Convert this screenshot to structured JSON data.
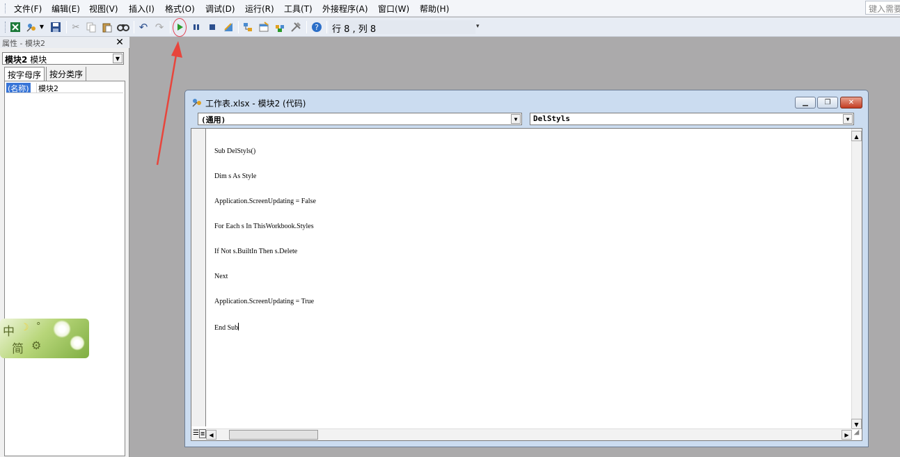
{
  "menubar": {
    "items": [
      {
        "label": "文件(F)"
      },
      {
        "label": "编辑(E)"
      },
      {
        "label": "视图(V)"
      },
      {
        "label": "插入(I)"
      },
      {
        "label": "格式(O)"
      },
      {
        "label": "调试(D)"
      },
      {
        "label": "运行(R)"
      },
      {
        "label": "工具(T)"
      },
      {
        "label": "外接程序(A)"
      },
      {
        "label": "窗口(W)"
      },
      {
        "label": "帮助(H)"
      }
    ],
    "search_placeholder": "键入需要"
  },
  "toolbar": {
    "icons": [
      "excel-icon",
      "insert-module-icon",
      "save-icon",
      "cut-icon",
      "copy-icon",
      "paste-icon",
      "find-icon",
      "undo-icon",
      "redo-icon",
      "run-icon",
      "break-icon",
      "reset-icon",
      "design-mode-icon",
      "project-explorer-icon",
      "properties-icon",
      "object-browser-icon",
      "toolbox-icon",
      "help-icon"
    ],
    "position_label": "行 8 , 列 8"
  },
  "properties_panel": {
    "title": "属性 - 模块2",
    "object_name_bold": "模块2",
    "object_type": "模块",
    "tabs": [
      {
        "label": "按字母序"
      },
      {
        "label": "按分类序"
      }
    ],
    "property_name": "(名称)",
    "property_value": "模块2"
  },
  "ime": {
    "mode_char": "中",
    "simplified_char": "简",
    "punct_symbol": "°"
  },
  "code_window": {
    "title": "工作表.xlsx - 模块2 (代码)",
    "object_select": "(通用)",
    "procedure_select": "DelStyls",
    "code_lines": [
      "Sub DelStyls()",
      "Dim s As Style",
      "Application.ScreenUpdating = False",
      "For Each s In ThisWorkbook.Styles",
      "If Not s.BuiltIn Then s.Delete",
      "Next",
      "Application.ScreenUpdating = True",
      "End Sub"
    ]
  },
  "colors": {
    "accent_highlight": "#e04050",
    "selection_blue": "#3875d7"
  }
}
